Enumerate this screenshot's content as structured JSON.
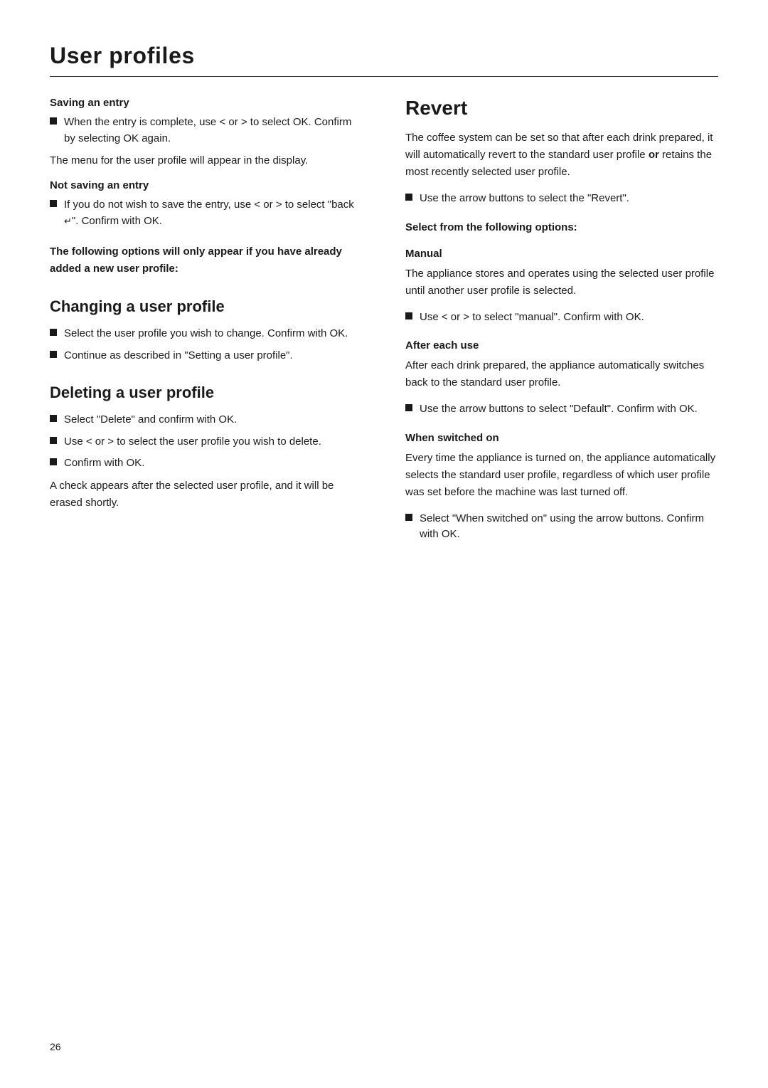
{
  "page": {
    "title": "User profiles",
    "page_number": "26"
  },
  "left_column": {
    "saving_entry": {
      "heading": "Saving an entry",
      "bullet1": "When the entry is complete, use < or > to select OK. Confirm by selecting OK again.",
      "paragraph1": "The menu for the user profile will appear in the display.",
      "not_saving_heading": "Not saving an entry",
      "not_saving_bullet1": "If you do not wish to save the entry, use < or > to select \"back ↵\". Confirm with OK."
    },
    "following_options": {
      "bold_paragraph": "The following options will only appear if you have already added a new user profile:"
    },
    "changing": {
      "title": "Changing a user profile",
      "bullet1": "Select the user profile you wish to change. Confirm with OK.",
      "bullet2": "Continue as described in \"Setting a user profile\"."
    },
    "deleting": {
      "title": "Deleting a user profile",
      "bullet1": "Select \"Delete\" and confirm with OK.",
      "bullet2": "Use < or > to select the user profile you wish to delete.",
      "bullet3": "Confirm with OK.",
      "paragraph1": "A check appears after the selected user profile, and it will be erased shortly."
    }
  },
  "right_column": {
    "revert": {
      "title": "Revert",
      "paragraph1": "The coffee system can be set so that after each drink prepared, it will automatically revert to the standard user profile or retains the most recently selected user profile.",
      "paragraph1_bold_word": "or",
      "bullet1": "Use the arrow buttons to select the \"Revert\"."
    },
    "select_options": {
      "heading": "Select from the following options:",
      "manual": {
        "subheading": "Manual",
        "paragraph1": "The appliance stores and operates using the selected user profile until another user profile is selected.",
        "bullet1": "Use < or > to select \"manual\". Confirm with OK."
      },
      "after_each_use": {
        "subheading": "After each use",
        "paragraph1": "After each drink prepared, the appliance automatically switches back to the standard user profile.",
        "bullet1": "Use the arrow buttons to select \"Default\". Confirm with OK."
      },
      "when_switched_on": {
        "subheading": "When switched on",
        "paragraph1": "Every time the appliance is turned on, the appliance automatically selects the standard user profile, regardless of which user profile was set before the machine was last turned off.",
        "bullet1": "Select \"When switched on\" using the arrow buttons. Confirm with OK."
      }
    }
  }
}
